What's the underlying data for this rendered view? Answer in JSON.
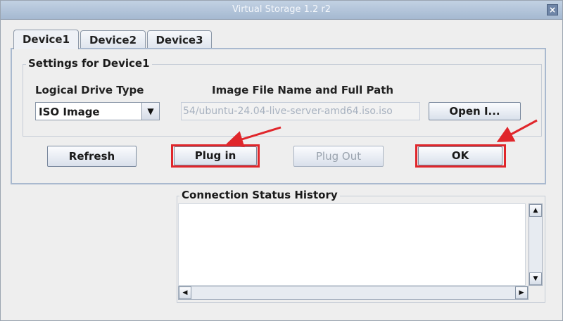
{
  "window": {
    "title": "Virtual Storage 1.2 r2",
    "close_icon": "close-icon"
  },
  "tabs": [
    {
      "label": "Device1",
      "active": true
    },
    {
      "label": "Device2",
      "active": false
    },
    {
      "label": "Device3",
      "active": false
    }
  ],
  "settings": {
    "group_title": "Settings for Device1",
    "drive_type_label": "Logical Drive Type",
    "drive_type_value": "ISO Image",
    "image_path_label": "Image File Name and Full Path",
    "image_path_value": "54/ubuntu-24.04-live-server-amd64.iso.iso",
    "open_button": "Open I..."
  },
  "actions": {
    "refresh": "Refresh",
    "plug_in": "Plug in",
    "plug_out": "Plug Out",
    "ok": "OK"
  },
  "status": {
    "group_title": "Connection Status History",
    "history_text": ""
  },
  "annotation_color": "#e0262b",
  "icons": {
    "dropdown": "chevron-down-icon",
    "scroll_up": "arrow-up-icon",
    "scroll_down": "arrow-down-icon",
    "scroll_left": "arrow-left-icon",
    "scroll_right": "arrow-right-icon"
  }
}
